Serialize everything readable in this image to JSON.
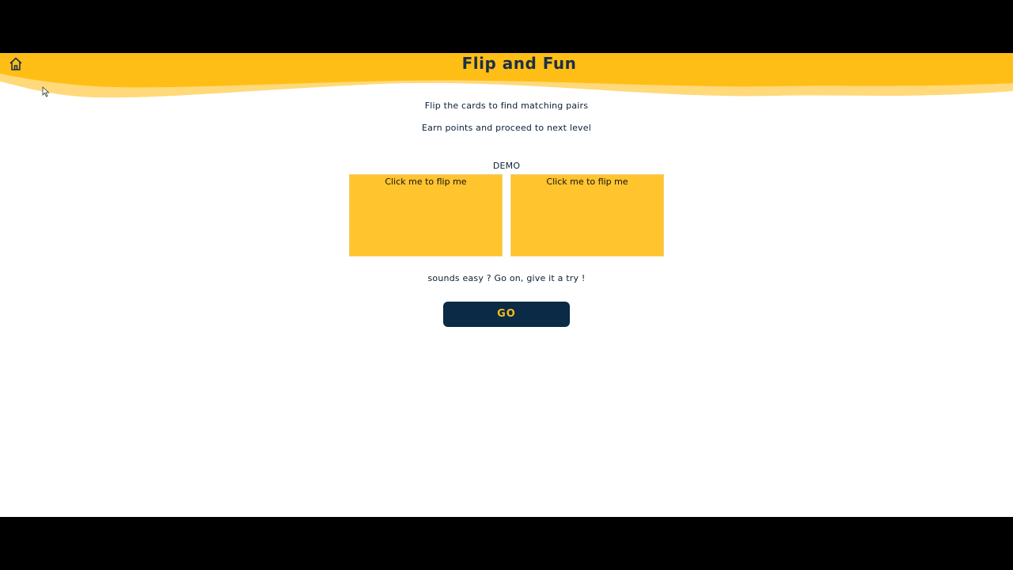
{
  "header": {
    "title": "Flip and Fun",
    "home_icon": "home-icon",
    "accent_color": "#ffbe16"
  },
  "intro": {
    "line1": "Flip the cards to find matching pairs",
    "line2": "Earn points and proceed to next level"
  },
  "demo": {
    "label": "DEMO",
    "cards": [
      {
        "label": "Click me to flip me"
      },
      {
        "label": "Click me to flip me"
      }
    ]
  },
  "prompt": "sounds easy ? Go on, give it a try !",
  "go_button": {
    "label": "GO",
    "bg_color": "#0a2a45",
    "text_color": "#f5bc1c"
  }
}
